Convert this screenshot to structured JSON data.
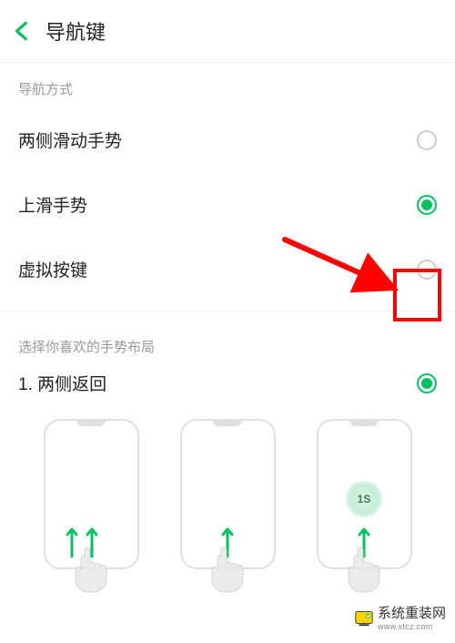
{
  "header": {
    "title": "导航键"
  },
  "nav_method": {
    "section_label": "导航方式",
    "options": [
      "两侧滑动手势",
      "上滑手势",
      "虚拟按键"
    ],
    "selected_index": 1
  },
  "gesture_layout": {
    "section_label": "选择你喜欢的手势布局",
    "option_label": "1. 两侧返回",
    "option_selected": true,
    "hold_badge": "1S"
  },
  "colors": {
    "accent": "#07c160",
    "annotation": "#ff0000"
  },
  "watermark": {
    "text": "系统重装网",
    "sub": "www.xtcz.com"
  }
}
